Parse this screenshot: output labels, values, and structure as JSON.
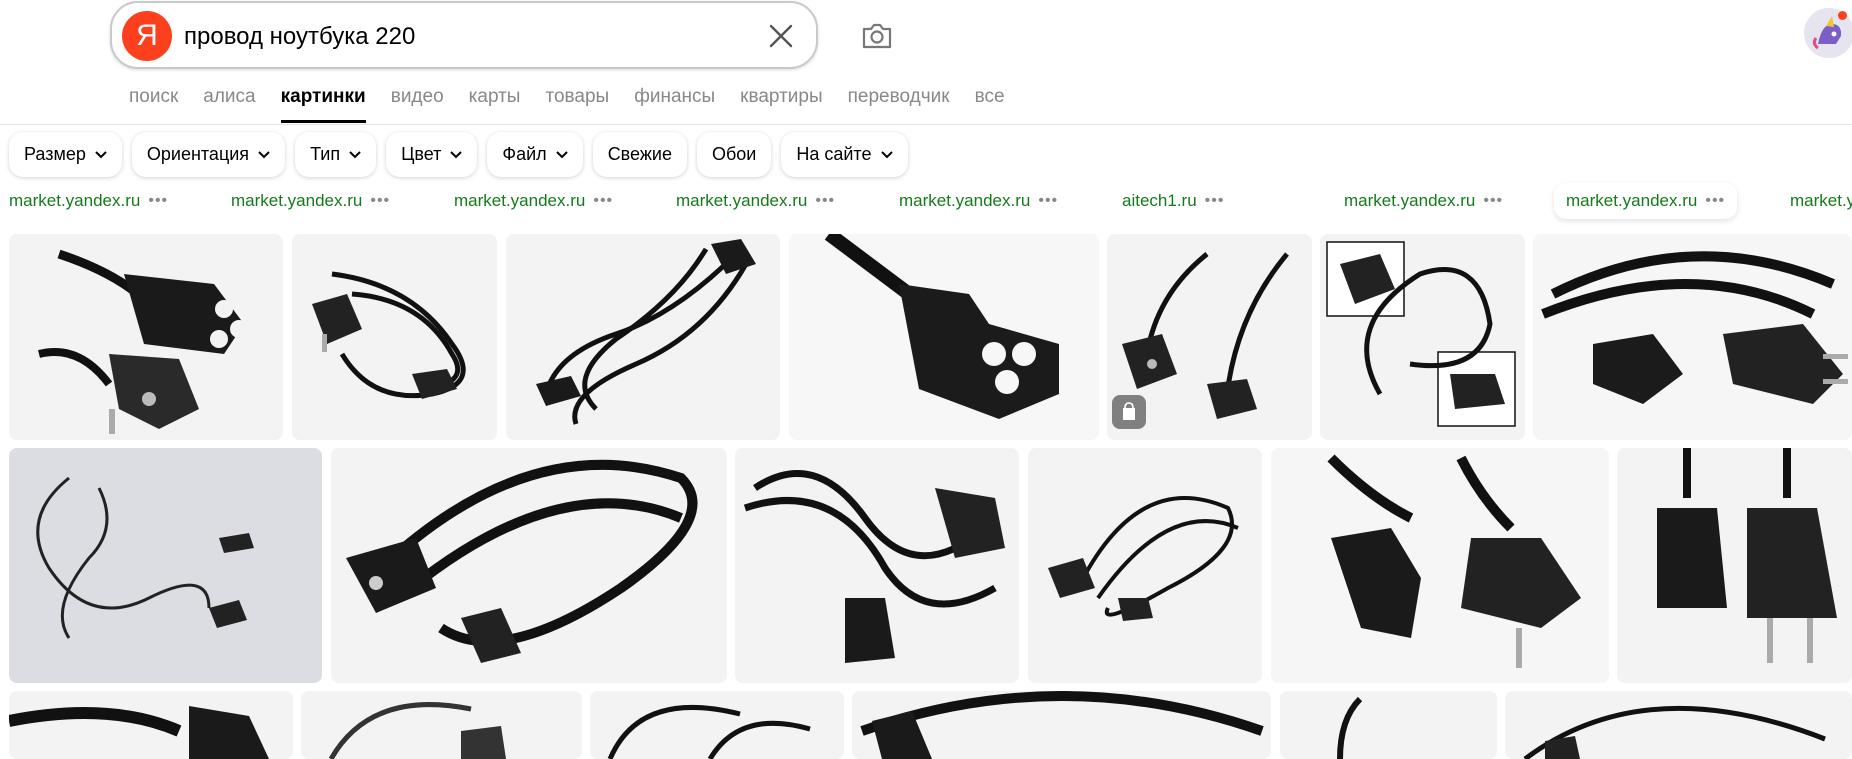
{
  "search": {
    "logo_letter": "Я",
    "query": "провод ноутбука 220"
  },
  "tabs": [
    "поиск",
    "алиса",
    "картинки",
    "видео",
    "карты",
    "товары",
    "финансы",
    "квартиры",
    "переводчик",
    "все"
  ],
  "active_tab": "картинки",
  "filters": [
    {
      "label": "Размер",
      "dropdown": true
    },
    {
      "label": "Ориентация",
      "dropdown": true
    },
    {
      "label": "Тип",
      "dropdown": true
    },
    {
      "label": "Цвет",
      "dropdown": true
    },
    {
      "label": "Файл",
      "dropdown": true
    },
    {
      "label": "Свежие",
      "dropdown": false
    },
    {
      "label": "Обои",
      "dropdown": false
    },
    {
      "label": "На сайте",
      "dropdown": true
    }
  ],
  "sources": [
    "market.yandex.ru",
    "market.yandex.ru",
    "market.yandex.ru",
    "market.yandex.ru",
    "market.yandex.ru",
    "aitech1.ru",
    "market.yandex.ru",
    "market.yandex.ru",
    "market.y"
  ],
  "colors": {
    "brand": "#fc3f1d",
    "source_link": "#147b1b",
    "tab_inactive": "#888888"
  },
  "icons": {
    "clear": "close-icon",
    "camera": "camera-icon",
    "chevron": "chevron-down-icon",
    "more": "more-dots-icon",
    "shop": "shopping-bag-icon"
  }
}
